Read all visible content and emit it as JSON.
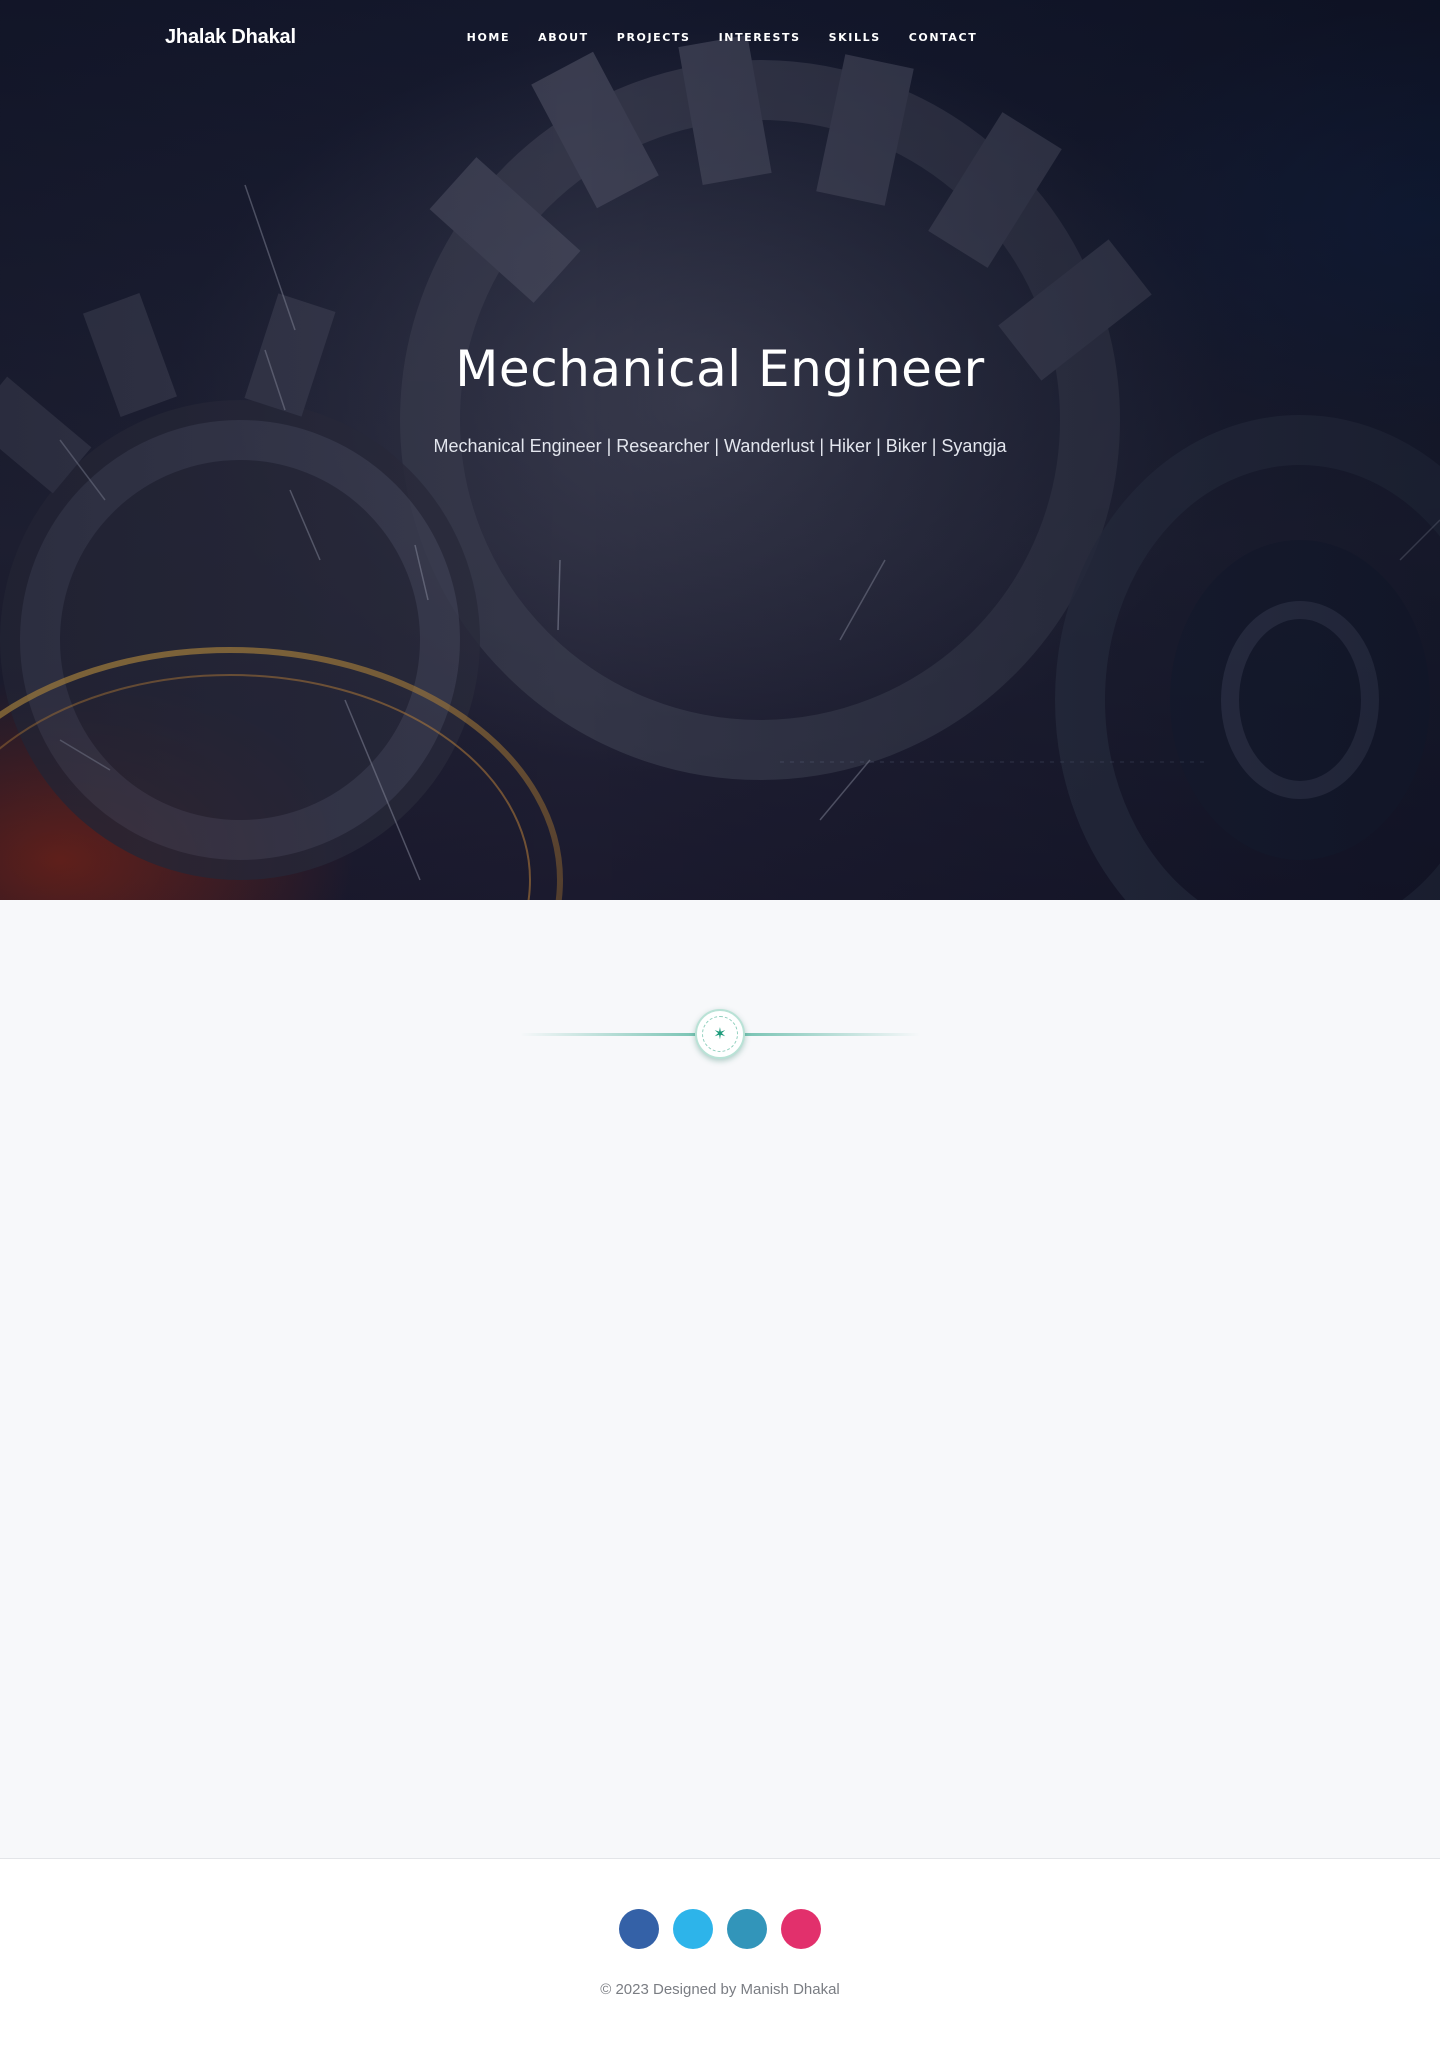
{
  "header": {
    "brand": "Jhalak Dhakal",
    "nav": [
      {
        "label": "HOME"
      },
      {
        "label": "ABOUT"
      },
      {
        "label": "PROJECTS"
      },
      {
        "label": "INTERESTS"
      },
      {
        "label": "SKILLS"
      },
      {
        "label": "CONTACT"
      }
    ]
  },
  "hero": {
    "title": "Mechanical Engineer",
    "subtitle": "Mechanical Engineer | Researcher | Wanderlust | Hiker | Biker | Syangja",
    "background_icon": "gears-photo"
  },
  "divider": {
    "icon": "asterisk-icon",
    "glyph": "✶",
    "accent": "#1c9a7a"
  },
  "footer": {
    "socials": [
      {
        "name": "facebook-icon",
        "color": "#3461a7"
      },
      {
        "name": "twitter-icon",
        "color": "#2db4ea"
      },
      {
        "name": "linkedin-icon",
        "color": "#3295ba"
      },
      {
        "name": "instagram-icon",
        "color": "#e2306c"
      }
    ],
    "copyright": "© 2023 Designed by Manish Dhakal"
  }
}
